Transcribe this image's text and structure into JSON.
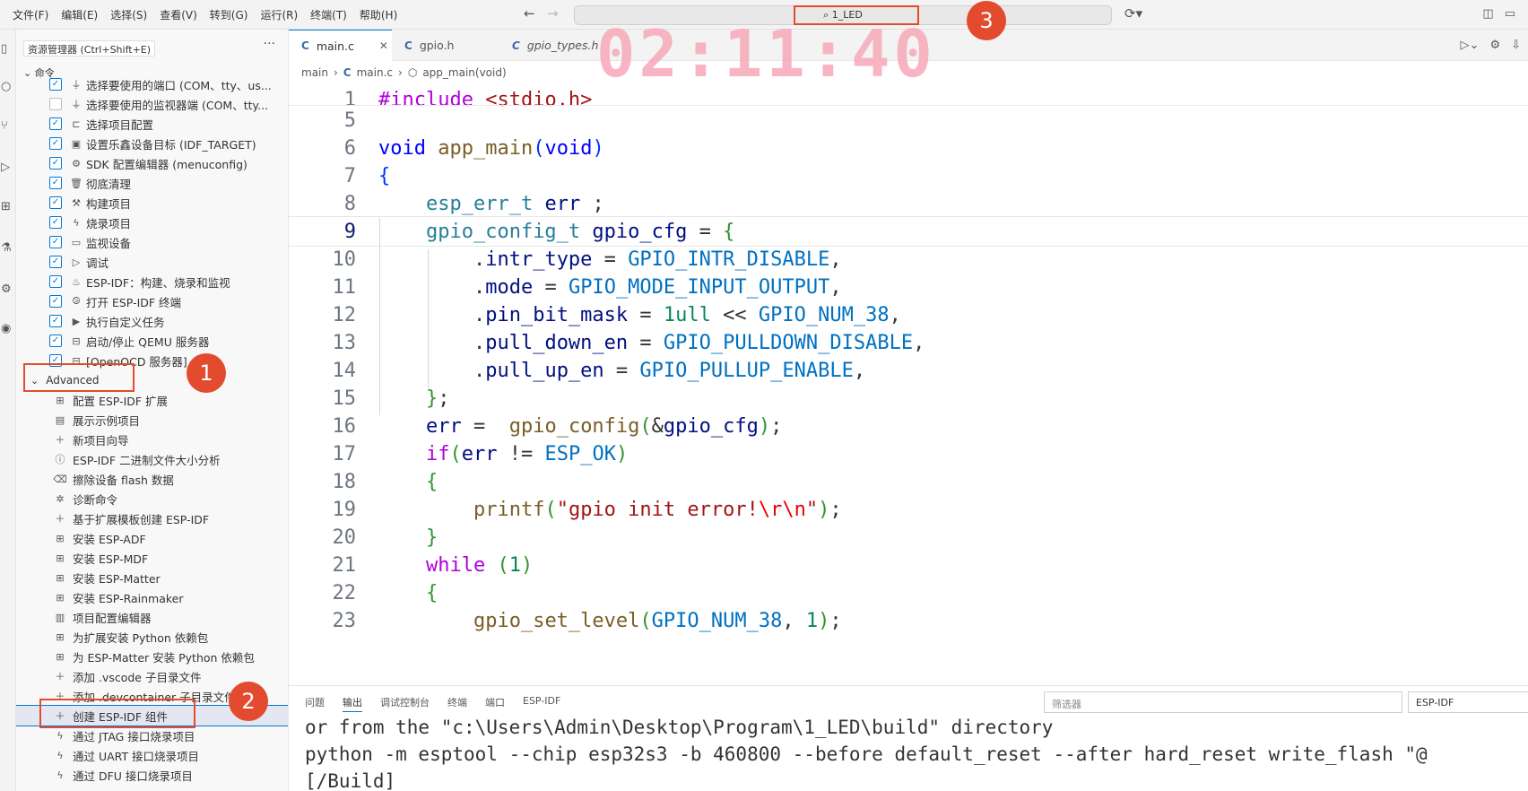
{
  "menu": [
    "文件(F)",
    "编辑(E)",
    "选择(S)",
    "查看(V)",
    "转到(G)",
    "运行(R)",
    "终端(T)",
    "帮助(H)"
  ],
  "command_center": {
    "text": "1_LED"
  },
  "sidebar": {
    "header": "资源管理器 (Ctrl+Shift+E)",
    "section": "命令",
    "commands": [
      {
        "label": "选择要使用的端口 (COM、tty、us...",
        "checked": true,
        "icon": "plug-icon"
      },
      {
        "label": "选择要使用的监视器端 (COM、tty...",
        "checked": false,
        "icon": "plug-icon"
      },
      {
        "label": "选择项目配置",
        "checked": true,
        "icon": "toggle-icon"
      },
      {
        "label": "设置乐鑫设备目标 (IDF_TARGET)",
        "checked": true,
        "icon": "chip-icon"
      },
      {
        "label": "SDK 配置编辑器 (menuconfig)",
        "checked": true,
        "icon": "gear-icon"
      },
      {
        "label": "彻底清理",
        "checked": true,
        "icon": "trash-icon"
      },
      {
        "label": "构建项目",
        "checked": true,
        "icon": "wrench-icon"
      },
      {
        "label": "烧录项目",
        "checked": true,
        "icon": "bolt-icon"
      },
      {
        "label": "监视设备",
        "checked": true,
        "icon": "monitor-icon"
      },
      {
        "label": "调试",
        "checked": true,
        "icon": "debug-icon"
      },
      {
        "label": "ESP-IDF：构建、烧录和监视",
        "checked": true,
        "icon": "flame-icon"
      },
      {
        "label": "打开 ESP-IDF 终端",
        "checked": true,
        "icon": "terminal-icon"
      },
      {
        "label": "执行自定义任务",
        "checked": true,
        "icon": "task-icon"
      },
      {
        "label": "启动/停止 QEMU 服务器",
        "checked": true,
        "icon": "server-icon"
      },
      {
        "label": "[OpenOCD 服务器]",
        "checked": true,
        "icon": "server-icon"
      }
    ],
    "advanced_label": "Advanced",
    "advanced_items": [
      {
        "label": "配置 ESP-IDF 扩展",
        "icon": "grid-icon"
      },
      {
        "label": "展示示例项目",
        "icon": "book-icon"
      },
      {
        "label": "新项目向导",
        "icon": "plus-icon"
      },
      {
        "label": "ESP-IDF 二进制文件大小分析",
        "icon": "info-icon"
      },
      {
        "label": "擦除设备 flash 数据",
        "icon": "erase-icon"
      },
      {
        "label": "诊断命令",
        "icon": "bug-icon"
      },
      {
        "label": "基于扩展模板创建 ESP-IDF",
        "icon": "plus-icon"
      },
      {
        "label": "安装 ESP-ADF",
        "icon": "grid-icon"
      },
      {
        "label": "安装 ESP-MDF",
        "icon": "grid-icon"
      },
      {
        "label": "安装 ESP-Matter",
        "icon": "grid-icon"
      },
      {
        "label": "安装 ESP-Rainmaker",
        "icon": "grid-icon"
      },
      {
        "label": "项目配置编辑器",
        "icon": "columns-icon"
      },
      {
        "label": "为扩展安装 Python 依赖包",
        "icon": "grid-icon"
      },
      {
        "label": "为 ESP-Matter 安装 Python 依赖包",
        "icon": "grid-icon"
      },
      {
        "label": "添加 .vscode 子目录文件",
        "icon": "plus-icon"
      },
      {
        "label": "添加 .devcontainer 子目录文件",
        "icon": "plus-icon"
      },
      {
        "label": "创建 ESP-IDF 组件",
        "icon": "plus-icon"
      },
      {
        "label": "通过 JTAG 接口烧录项目",
        "icon": "bolt-icon"
      },
      {
        "label": "通过 UART 接口烧录项目",
        "icon": "bolt-icon"
      },
      {
        "label": "通过 DFU 接口烧录项目",
        "icon": "bolt-icon"
      }
    ]
  },
  "tabs": [
    {
      "label": "main.c",
      "active": true
    },
    {
      "label": "gpio.h",
      "active": false
    },
    {
      "label": "gpio_types.h",
      "active": false
    }
  ],
  "breadcrumb": {
    "folder": "main",
    "file": "main.c",
    "symbol": "app_main(void)"
  },
  "code": {
    "line_numbers": [
      "1",
      "5",
      "6",
      "7",
      "8",
      "9",
      "10",
      "11",
      "12",
      "13",
      "14",
      "15",
      "16",
      "17",
      "18",
      "19",
      "20",
      "21",
      "22",
      "23"
    ],
    "current_line": "9"
  },
  "panel": {
    "tabs": [
      "问题",
      "输出",
      "调试控制台",
      "终端",
      "端口",
      "ESP-IDF"
    ],
    "active_tab": "输出",
    "filter_placeholder": "筛选器",
    "channel": "ESP-IDF",
    "output_lines": [
      "or from the \"c:\\Users\\Admin\\Desktop\\Program\\1_LED\\build\" directory",
      "python -m esptool --chip esp32s3 -b 460800 --before default_reset --after hard_reset write_flash \"@",
      "[/Build]"
    ]
  },
  "overlay": {
    "clock": "02:11:40",
    "badges": [
      "1",
      "2",
      "3"
    ]
  },
  "colors": {
    "annotation": "#e34b2e",
    "clock": "#f7a8b8",
    "accent": "#0078d4"
  }
}
